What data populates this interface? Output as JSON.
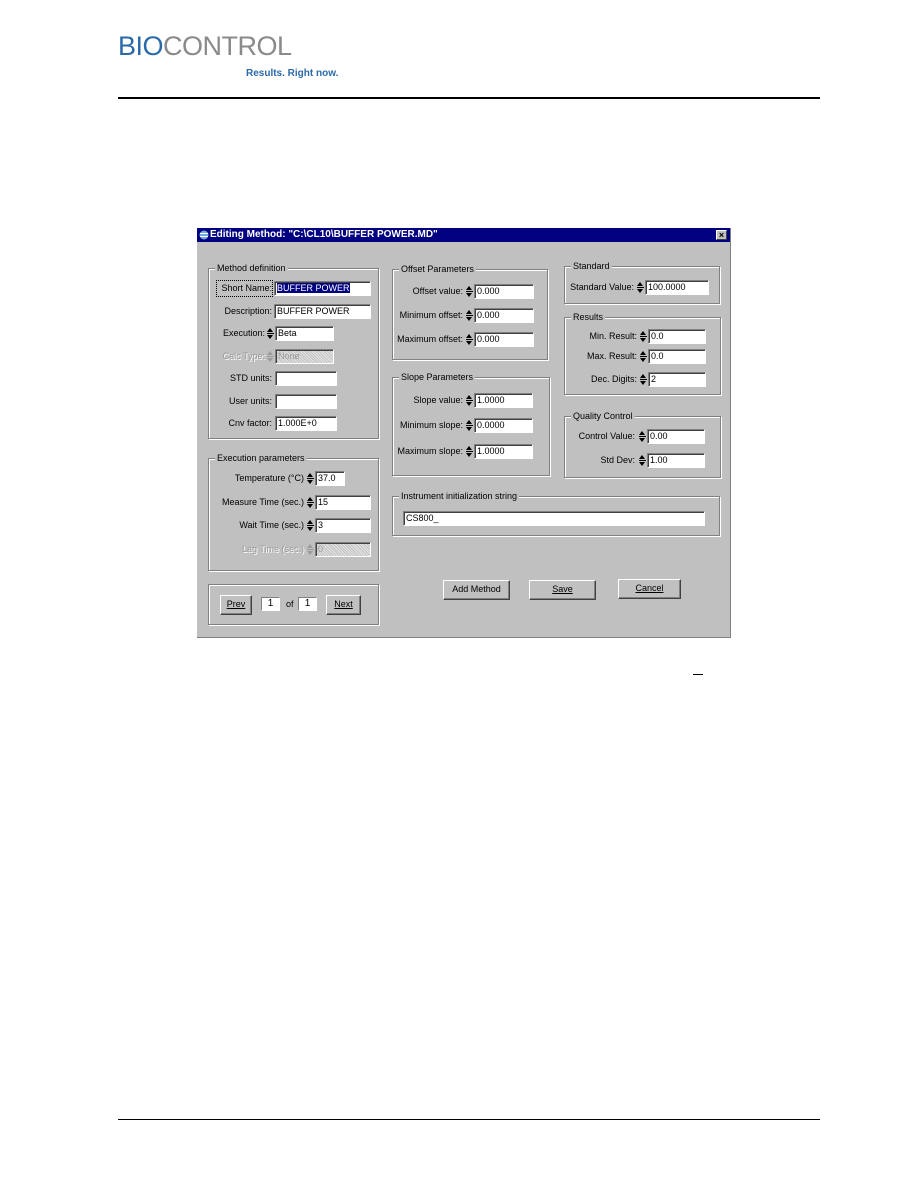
{
  "header": {
    "logo_part1": "BIO",
    "logo_part2": "CONTROL",
    "tagline": "Results. Right now."
  },
  "dialog": {
    "title": "Editing Method: \"C:\\CL10\\BUFFER POWER.MD\"",
    "close_label": "×",
    "method_definition": {
      "legend": "Method definition",
      "short_name": {
        "label": "Short Name:",
        "value": "BUFFER POWER"
      },
      "description": {
        "label": "Description:",
        "value": "BUFFER POWER"
      },
      "execution": {
        "label": "Execution:",
        "value": "Beta"
      },
      "calc_type": {
        "label": "Calc Type:",
        "value": "None"
      },
      "std_units": {
        "label": "STD units:",
        "value": ""
      },
      "user_units": {
        "label": "User units:",
        "value": ""
      },
      "cnv_factor": {
        "label": "Cnv factor:",
        "value": "1.000E+0"
      }
    },
    "execution_parameters": {
      "legend": "Execution parameters",
      "temperature": {
        "label": "Temperature (°C)",
        "value": "37.0"
      },
      "measure_time": {
        "label": "Measure Time (sec.)",
        "value": "15"
      },
      "wait_time": {
        "label": "Wait Time (sec.)",
        "value": "3"
      },
      "lag_time": {
        "label": "Lag Time (sec.)",
        "value": "0"
      }
    },
    "pager": {
      "prev_label": "Prev",
      "current": "1",
      "of_label": "of",
      "total": "1",
      "next_label": "Next"
    },
    "offset_parameters": {
      "legend": "Offset Parameters",
      "offset_value": {
        "label": "Offset value:",
        "value": "0.000"
      },
      "minimum_offset": {
        "label": "Minimum offset:",
        "value": "0.000"
      },
      "maximum_offset": {
        "label": "Maximum offset:",
        "value": "0.000"
      }
    },
    "slope_parameters": {
      "legend": "Slope Parameters",
      "slope_value": {
        "label": "Slope value:",
        "value": "1.0000"
      },
      "minimum_slope": {
        "label": "Minimum slope:",
        "value": "0.0000"
      },
      "maximum_slope": {
        "label": "Maximum slope:",
        "value": "1.0000"
      }
    },
    "standard": {
      "legend": "Standard",
      "standard_value": {
        "label": "Standard Value:",
        "value": "100.0000"
      }
    },
    "results": {
      "legend": "Results",
      "min_result": {
        "label": "Min. Result:",
        "value": "0.0"
      },
      "max_result": {
        "label": "Max. Result:",
        "value": "0.0"
      },
      "dec_digits": {
        "label": "Dec. Digits:",
        "value": "2"
      }
    },
    "quality_control": {
      "legend": "Quality Control",
      "control_value": {
        "label": "Control Value:",
        "value": "0.00"
      },
      "std_dev": {
        "label": "Std Dev:",
        "value": "1.00"
      }
    },
    "instrument": {
      "legend": "Instrument initialization string",
      "value": "CS800_"
    },
    "buttons": {
      "add_method": "Add Method",
      "save": "Save",
      "cancel": "Cancel"
    }
  }
}
